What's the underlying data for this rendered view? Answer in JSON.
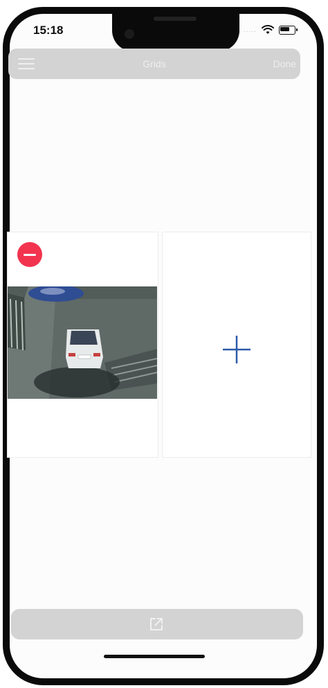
{
  "status_bar": {
    "time": "15:18",
    "signal": "....."
  },
  "nav_bar": {
    "title": "Grids",
    "done_label": "Done"
  },
  "grid": {
    "cells": [
      {
        "type": "camera",
        "thumbnail": "car-parking-camera-view",
        "remove_icon": "minus-circle-icon"
      },
      {
        "type": "empty",
        "add_icon": "plus-icon"
      }
    ]
  },
  "bottom_toolbar": {
    "share_icon": "share-export-icon"
  },
  "colors": {
    "bar_gray": "#d3d3d3",
    "remove_red": "#f2344f",
    "add_blue": "#2a5aa8"
  }
}
